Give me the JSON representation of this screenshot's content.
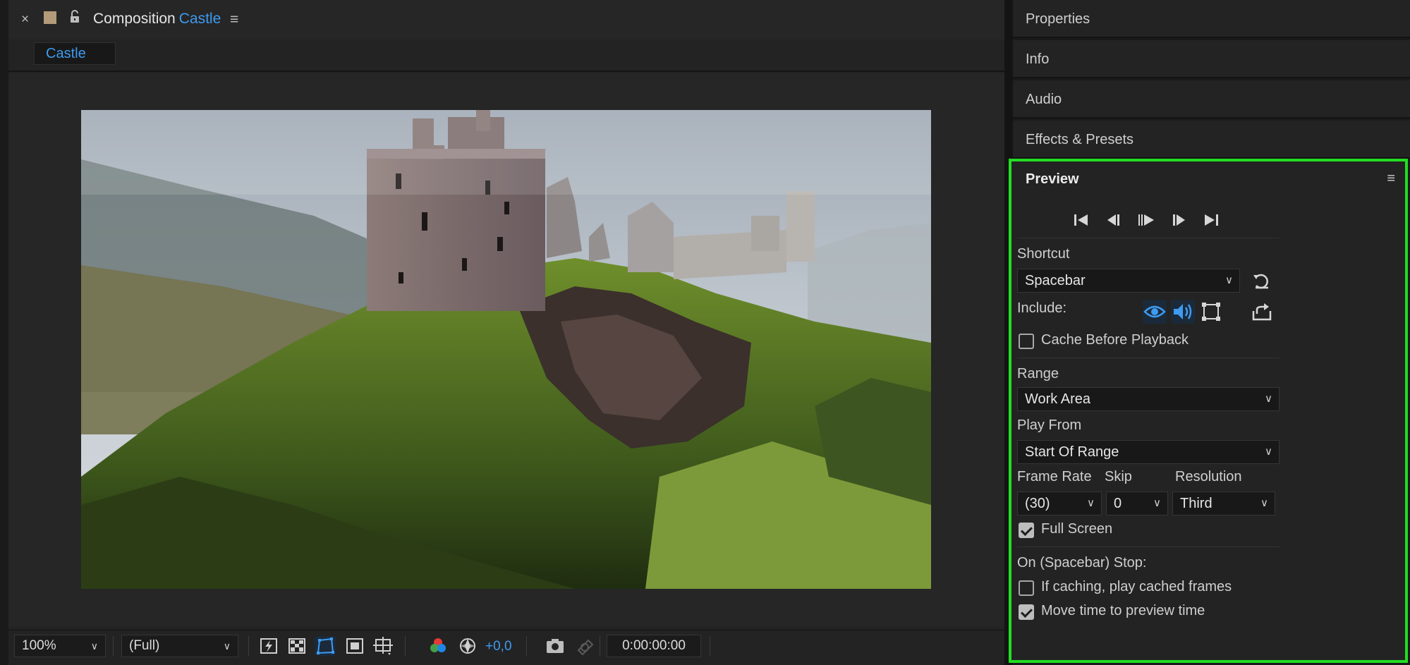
{
  "composition": {
    "close_glyph": "×",
    "panel_label": "Composition",
    "comp_name": "Castle",
    "menu_glyph": "≡",
    "tab_label": "Castle",
    "swatch_color": "#b39a78",
    "accent_color": "#3e9bf0"
  },
  "viewer": {
    "image_subject": "castle ruins on a green hill under a cloudy sky"
  },
  "bottom_bar": {
    "zoom_value": "100%",
    "resolution_value": "(Full)",
    "exposure_value": "+0,0",
    "timecode": "0:00:00:00",
    "icons": [
      "fast-previews-icon",
      "transparency-grid-icon",
      "mask-path-icon",
      "region-of-interest-icon",
      "guides-grid-icon",
      "channel-icon",
      "exposure-reset-icon",
      "snapshot-icon",
      "show-snapshot-icon"
    ]
  },
  "right_panels": {
    "headers": [
      "Properties",
      "Info",
      "Audio",
      "Effects & Presets"
    ]
  },
  "preview": {
    "title": "Preview",
    "menu_glyph": "≡",
    "transport": [
      "first-frame-icon",
      "previous-frame-icon",
      "play-icon",
      "next-frame-icon",
      "last-frame-icon"
    ],
    "shortcut_label": "Shortcut",
    "shortcut_value": "Spacebar",
    "include_label": "Include:",
    "cache_before_playback": "Cache Before Playback",
    "range_label": "Range",
    "range_value": "Work Area",
    "play_from_label": "Play From",
    "play_from_value": "Start Of Range",
    "frame_rate_label": "Frame Rate",
    "skip_label": "Skip",
    "resolution_label": "Resolution",
    "frame_rate_value": "(30)",
    "skip_value": "0",
    "resolution_value": "Third",
    "full_screen": "Full Screen",
    "on_stop_label": "On (Spacebar) Stop:",
    "if_caching": "If caching, play cached frames",
    "move_time": "Move time to preview time",
    "checked": {
      "cache_before_playback": false,
      "full_screen": true,
      "if_caching": false,
      "move_time": true
    },
    "highlight_color": "#22dd22"
  }
}
